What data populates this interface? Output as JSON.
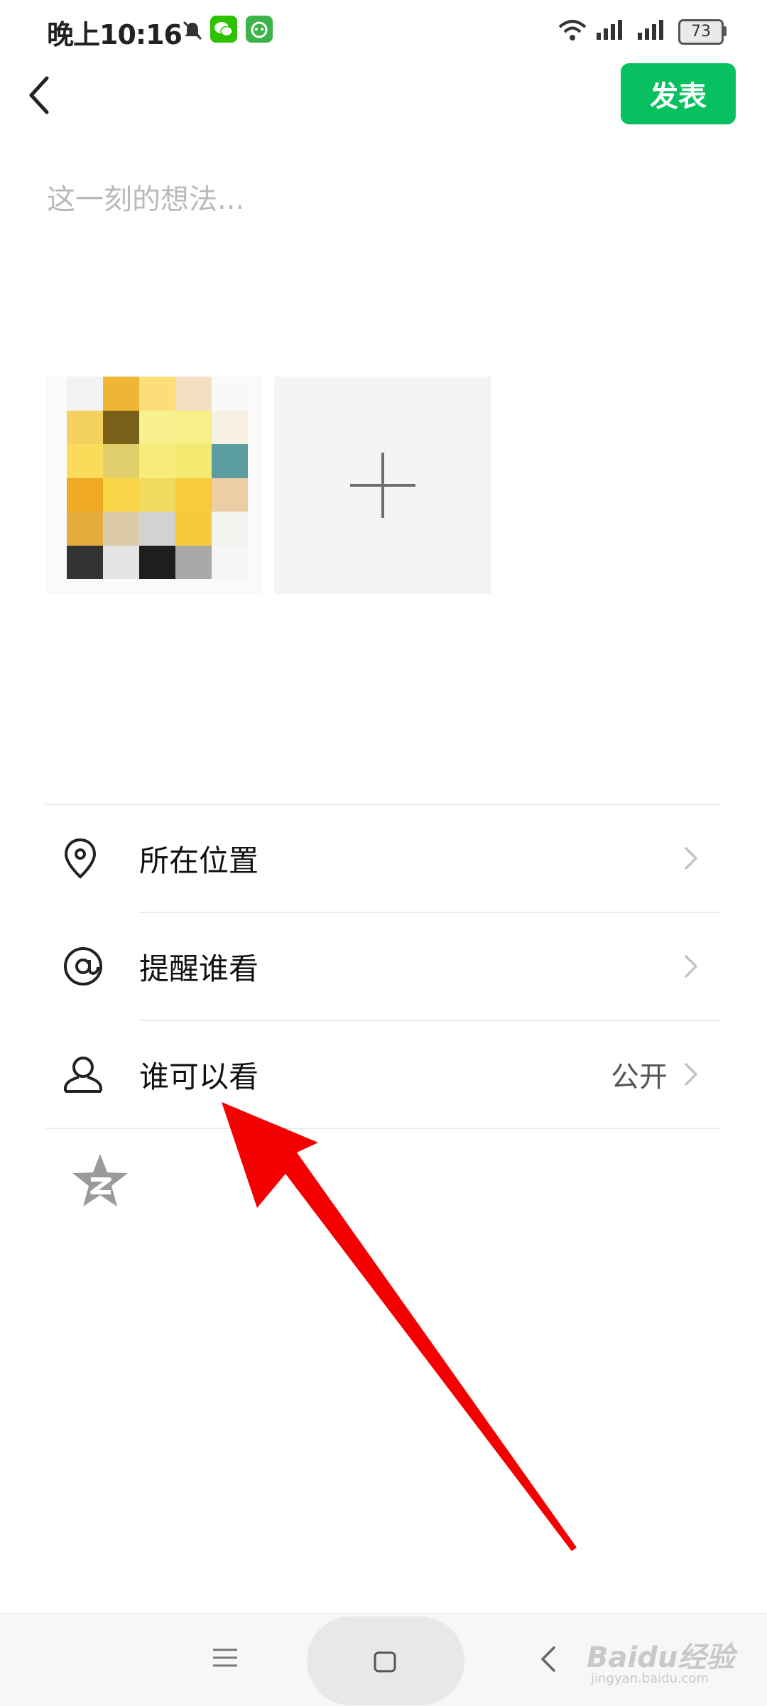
{
  "status_bar": {
    "time": "晚上10:16",
    "battery": "73",
    "icons": [
      "mute-bell-icon",
      "wechat-icon",
      "app-icon",
      "wifi-icon",
      "signal-icon",
      "signal-icon"
    ]
  },
  "header": {
    "back_icon": "chevron-left-icon",
    "publish_label": "发表",
    "accent_color": "#07c160"
  },
  "composer": {
    "placeholder": "这一刻的想法...",
    "photos": [
      {
        "kind": "pixelated-image"
      },
      {
        "kind": "add-photo",
        "icon": "plus-icon"
      }
    ]
  },
  "options": [
    {
      "icon": "location-pin-icon",
      "label": "所在位置",
      "value": ""
    },
    {
      "icon": "at-sign-icon",
      "label": "提醒谁看",
      "value": ""
    },
    {
      "icon": "person-icon",
      "label": "谁可以看",
      "value": "公开"
    }
  ],
  "extra": {
    "icon": "qzone-star-icon"
  },
  "annotation": {
    "type": "red-arrow",
    "color": "#f40000"
  },
  "nav_bar": {
    "icons": [
      "menu-icon",
      "home-icon",
      "back-icon"
    ]
  },
  "watermark": {
    "text": "Baidu经验",
    "sub": "jingyan.baidu.com"
  }
}
